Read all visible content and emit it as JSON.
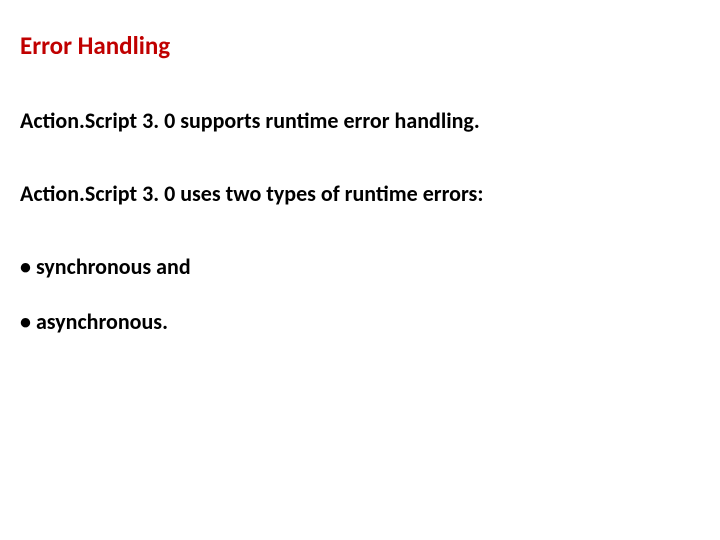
{
  "title": "Error Handling",
  "line1": "Action.Script 3. 0 supports runtime error handling.",
  "line2": "Action.Script 3. 0 uses two types of runtime errors:",
  "bullets": [
    "synchronous and",
    "asynchronous."
  ]
}
